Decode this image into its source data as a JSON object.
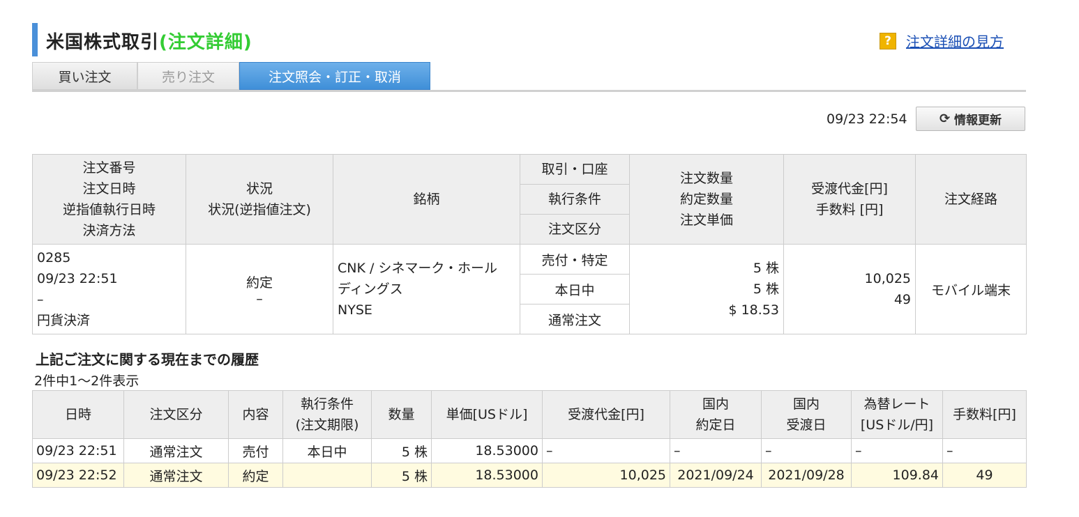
{
  "header": {
    "title_main": "米国株式取引",
    "title_sub": "(注文詳細)",
    "help_icon": "?",
    "help_link": "注文詳細の見方"
  },
  "tabs": [
    {
      "label": "買い注文"
    },
    {
      "label": "売り注文"
    },
    {
      "label": "注文照会・訂正・取消"
    }
  ],
  "refresh": {
    "timestamp": "09/23 22:54",
    "button_label": "情報更新",
    "icon": "refresh-icon"
  },
  "order_table": {
    "headers": {
      "col1": [
        "注文番号",
        "注文日時",
        "逆指値執行日時",
        "決済方法"
      ],
      "col2": [
        "状況",
        "状況(逆指値注文)"
      ],
      "col3": "銘柄",
      "col4": [
        "取引・口座",
        "執行条件",
        "注文区分"
      ],
      "col5": [
        "注文数量",
        "約定数量",
        "注文単価"
      ],
      "col6": [
        "受渡代金[円]",
        "手数料 [円]"
      ],
      "col7": "注文経路"
    },
    "row": {
      "order_no": "0285",
      "order_datetime": "09/23 22:51",
      "stop_datetime": "–",
      "settlement": "円貨決済",
      "status": "約定",
      "status_stop": "–",
      "symbol_line1": "CNK / シネマーク・ホール",
      "symbol_line2": "ディングス",
      "market": "NYSE",
      "trade_account": "売付・特定",
      "exec_condition": "本日中",
      "order_type": "通常注文",
      "order_qty": "5 株",
      "filled_qty": "5 株",
      "unit_price": "$ 18.53",
      "settlement_amount": "10,025",
      "fee": "49",
      "route": "モバイル端末"
    }
  },
  "history": {
    "title": "上記ご注文に関する現在までの履歴",
    "count": "2件中1～2件表示",
    "headers": [
      "日時",
      "注文区分",
      "内容",
      "執行条件\n(注文期限)",
      "数量",
      "単価[USドル]",
      "受渡代金[円]",
      "国内\n約定日",
      "国内\n受渡日",
      "為替レート\n[USドル/円]",
      "手数料[円]"
    ],
    "rows": [
      [
        "09/23 22:51",
        "通常注文",
        "売付",
        "本日中",
        "5 株",
        "18.53000",
        "–",
        "–",
        "–",
        "–",
        "–"
      ],
      [
        "09/23 22:52",
        "通常注文",
        "約定",
        "",
        "5 株",
        "18.53000",
        "10,025",
        "2021/09/24",
        "2021/09/28",
        "109.84",
        "49"
      ]
    ]
  }
}
